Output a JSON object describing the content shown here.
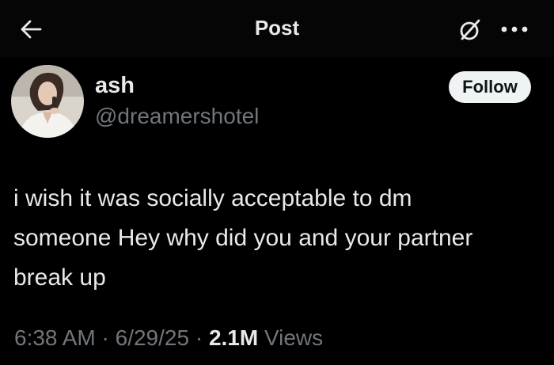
{
  "header": {
    "title": "Post",
    "icons": {
      "back": "arrow-left-icon",
      "grok": "grok-icon",
      "more": "more-horizontal-icon"
    }
  },
  "author": {
    "display_name": "ash",
    "handle": "@dreamershotel",
    "avatar": "avatar"
  },
  "follow_button": {
    "label": "Follow"
  },
  "post": {
    "lines": [
      "i wish it was socially acceptable to dm",
      "someone Hey why did you and your partner",
      "break up"
    ]
  },
  "meta": {
    "time": "6:38 AM",
    "sep1": " · ",
    "date": "6/29/25",
    "sep2": " · ",
    "views_count": "2.1M",
    "views_label": " Views"
  },
  "colors": {
    "background": "#000000",
    "header_bg": "#050505",
    "text_primary": "#e7e9ea",
    "text_secondary": "#71767b",
    "follow_bg": "#eff3f4",
    "follow_text": "#0f1419"
  }
}
